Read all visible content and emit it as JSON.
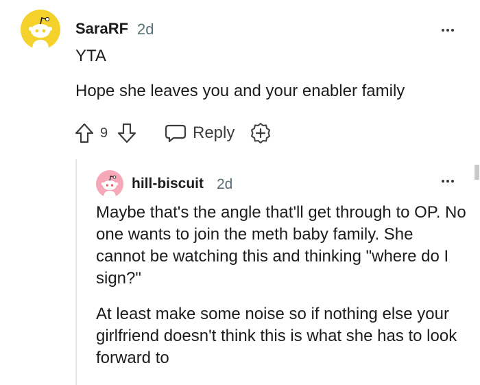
{
  "colors": {
    "text": "#1c1c1c",
    "meta": "#576f76",
    "icon": "#3c3c3c",
    "avatar_main_bg": "#f5d22b",
    "avatar_reply_bg": "#f7a8b8",
    "thread_line": "#e5e7e9"
  },
  "comment": {
    "avatar_icon": "reddit-snoo-avatar-icon",
    "author": "SaraRF",
    "age": "2d",
    "more_icon": "ellipsis-icon",
    "paragraphs": [
      "YTA",
      "Hope she leaves you and your enabler family"
    ],
    "actions": {
      "upvote_icon": "arrow-up-icon",
      "score": "9",
      "downvote_icon": "arrow-down-icon",
      "reply_icon": "speech-bubble-icon",
      "reply_label": "Reply",
      "award_icon": "award-plus-icon"
    }
  },
  "reply": {
    "avatar_icon": "reddit-snoo-avatar-icon",
    "author": "hill-biscuit",
    "age": "2d",
    "more_icon": "ellipsis-icon",
    "paragraphs": [
      "Maybe that's the angle that'll get through to OP. No one wants to join the meth baby family. She cannot be watching this and thinking \"where do I sign?\"",
      "At least make some noise so if nothing else your girlfriend doesn't think this is what she has to look forward to"
    ]
  }
}
